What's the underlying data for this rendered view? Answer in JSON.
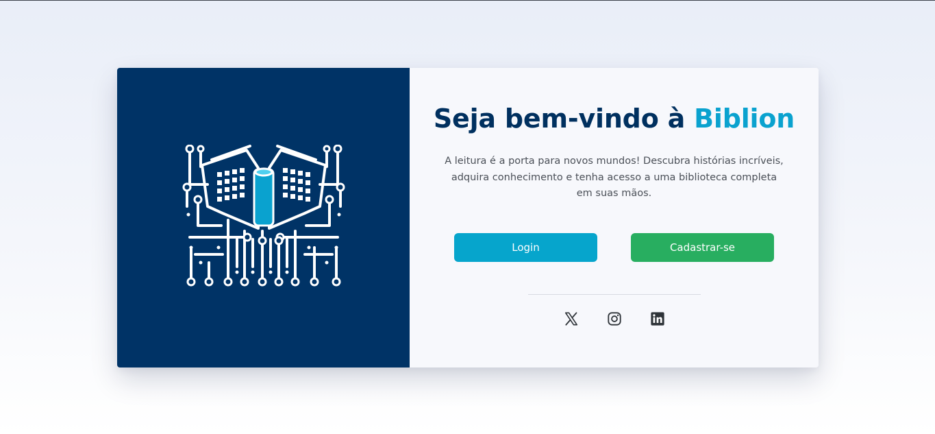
{
  "welcome": {
    "title_prefix": "Seja bem-vindo à ",
    "title_brand": "Biblion",
    "description": "A leitura é a porta para novos mundos! Descubra histórias incríveis, adquira conhecimento e tenha acesso a uma biblioteca completa em suas mãos."
  },
  "actions": {
    "login_label": "Login",
    "signup_label": "Cadastrar-se"
  },
  "social": [
    {
      "name": "x-icon"
    },
    {
      "name": "instagram-icon"
    },
    {
      "name": "linkedin-icon"
    }
  ],
  "colors": {
    "panel_navy": "#003366",
    "brand_cyan": "#0aa2cf",
    "login_button": "#06a5cc",
    "signup_button": "#28ae60",
    "title_navy": "#00305f"
  }
}
